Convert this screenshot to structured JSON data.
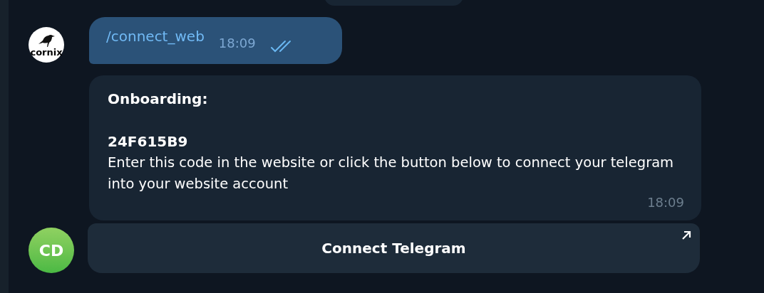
{
  "messages": [
    {
      "kind": "outgoing",
      "avatar": {
        "kind": "logo",
        "text": "cornix"
      },
      "text": "/connect_web",
      "time": "18:09",
      "read": true
    },
    {
      "kind": "incoming",
      "title": "Onboarding:",
      "code": "24F615B9",
      "body": "Enter this code in the website or click the button below to connect your telegram into your website account",
      "time": "18:09",
      "button": "Connect Telegram",
      "avatar": {
        "kind": "initials",
        "text": "CD"
      }
    }
  ]
}
